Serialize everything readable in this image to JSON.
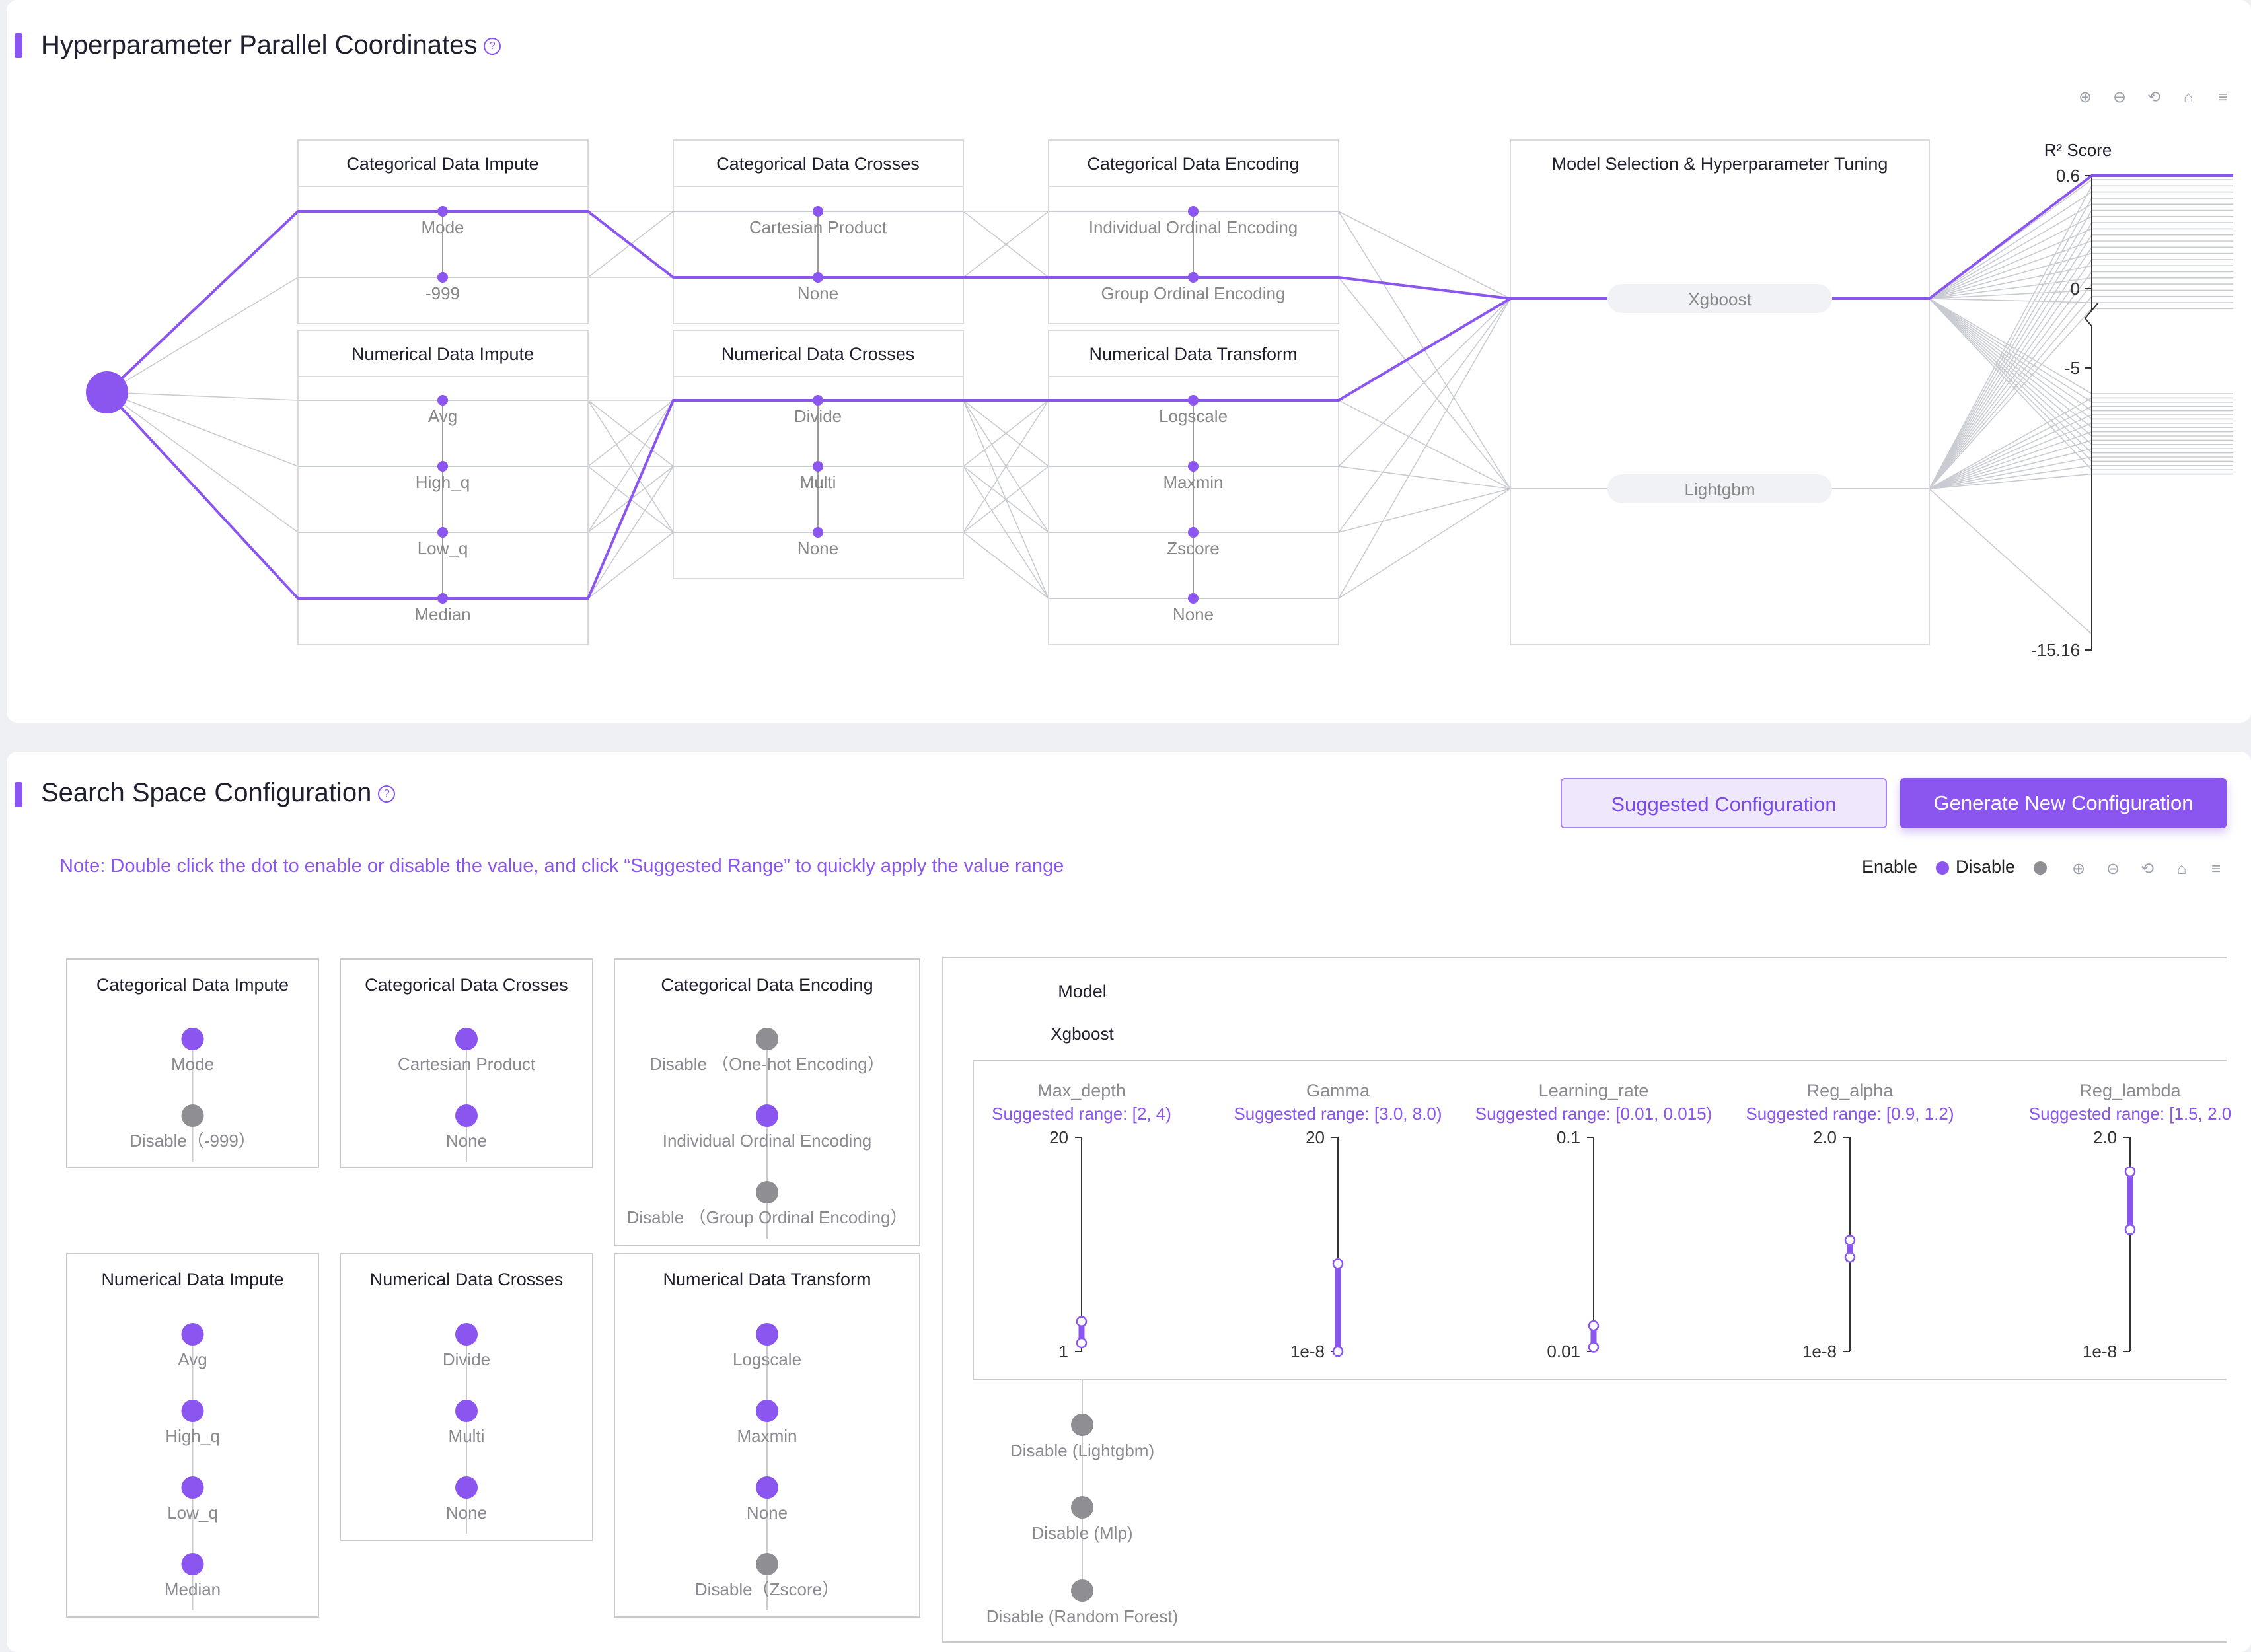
{
  "coords": {
    "title": "Hyperparameter Parallel Coordinates",
    "help": "?",
    "toolbar": [
      "zoom-in-icon",
      "zoom-out-icon",
      "restore-icon",
      "home-icon",
      "menu-icon"
    ],
    "axes": [
      {
        "title": "Categorical Data Impute",
        "values": [
          "Mode",
          "-999"
        ]
      },
      {
        "title": "Numerical Data Impute",
        "values": [
          "Avg",
          "High_q",
          "Low_q",
          "Median"
        ]
      },
      {
        "title": "Categorical Data Crosses",
        "values": [
          "Cartesian Product",
          "None"
        ]
      },
      {
        "title": "Numerical Data Crosses",
        "values": [
          "Divide",
          "Multi",
          "None"
        ]
      },
      {
        "title": "Categorical Data Encoding",
        "values": [
          "Individual Ordinal Encoding",
          "Group Ordinal Encoding"
        ]
      },
      {
        "title": "Numerical Data Transform",
        "values": [
          "Logscale",
          "Maxmin",
          "Zscore",
          "None"
        ]
      },
      {
        "title": "Model Selection & Hyperparameter Tuning",
        "values": [
          "Xgboost",
          "Lightgbm"
        ]
      }
    ],
    "score_axis": {
      "title": "R² Score",
      "ticks": [
        "0.6",
        "0",
        "-5",
        "-15.16"
      ]
    },
    "highlighted_path": [
      "Mode",
      "None",
      "Group Ordinal Encoding",
      "Median",
      "Divide",
      "Logscale",
      "Xgboost"
    ]
  },
  "config": {
    "title": "Search Space Configuration",
    "help": "?",
    "buttons": {
      "suggested": "Suggested Configuration",
      "generate": "Generate New Configuration"
    },
    "note": "Note: Double click the dot to enable or disable the value, and click “Suggested Range” to quickly apply the value range",
    "legend": {
      "enable": "Enable",
      "disable": "Disable"
    },
    "colors": {
      "enable": "#8b55f0",
      "disable": "#8e8e93"
    },
    "toolbar": [
      "zoom-in-icon",
      "zoom-out-icon",
      "restore-icon",
      "home-icon",
      "menu-icon"
    ],
    "boxes": [
      {
        "title": "Categorical Data Impute",
        "items": [
          {
            "label": "Mode",
            "enabled": true
          },
          {
            "label": "Disable（-999）",
            "enabled": false
          }
        ]
      },
      {
        "title": "Categorical Data Crosses",
        "items": [
          {
            "label": "Cartesian Product",
            "enabled": true
          },
          {
            "label": "None",
            "enabled": true
          }
        ]
      },
      {
        "title": "Categorical Data Encoding",
        "items": [
          {
            "label": "Disable （One-hot Encoding）",
            "enabled": false
          },
          {
            "label": "Individual Ordinal Encoding",
            "enabled": true
          },
          {
            "label": "Disable （Group Ordinal Encoding）",
            "enabled": false
          }
        ]
      },
      {
        "title": "Numerical Data Impute",
        "items": [
          {
            "label": "Avg",
            "enabled": true
          },
          {
            "label": "High_q",
            "enabled": true
          },
          {
            "label": "Low_q",
            "enabled": true
          },
          {
            "label": "Median",
            "enabled": true
          }
        ]
      },
      {
        "title": "Numerical Data Crosses",
        "items": [
          {
            "label": "Divide",
            "enabled": true
          },
          {
            "label": "Multi",
            "enabled": true
          },
          {
            "label": "None",
            "enabled": true
          }
        ]
      },
      {
        "title": "Numerical Data Transform",
        "items": [
          {
            "label": "Logscale",
            "enabled": true
          },
          {
            "label": "Maxmin",
            "enabled": true
          },
          {
            "label": "None",
            "enabled": true
          },
          {
            "label": "Disable（Zscore）",
            "enabled": false
          }
        ]
      }
    ],
    "model": {
      "title": "Model",
      "selected": "Xgboost",
      "params": [
        {
          "name": "Max_depth",
          "suggest": "Suggested range: [2, 4)",
          "top": "20",
          "bottom": "1",
          "range": [
            0.04,
            0.14
          ]
        },
        {
          "name": "Gamma",
          "suggest": "Suggested range: [3.0, 8.0)",
          "top": "20",
          "bottom": "1e-8",
          "range": [
            0.0,
            0.41
          ]
        },
        {
          "name": "Learning_rate",
          "suggest": "Suggested range: [0.01, 0.015)",
          "top": "0.1",
          "bottom": "0.01",
          "range": [
            0.02,
            0.12
          ]
        },
        {
          "name": "Reg_alpha",
          "suggest": "Suggested range: [0.9, 1.2)",
          "top": "2.0",
          "bottom": "1e-8",
          "range": [
            0.44,
            0.52
          ]
        },
        {
          "name": "Reg_lambda",
          "suggest": "Suggested range: [1.5, 2.0",
          "top": "2.0",
          "bottom": "1e-8",
          "range": [
            0.57,
            0.84
          ]
        }
      ],
      "disabled_models": [
        "Disable (Lightgbm)",
        "Disable (Mlp)",
        "Disable (Random Forest)"
      ]
    }
  }
}
